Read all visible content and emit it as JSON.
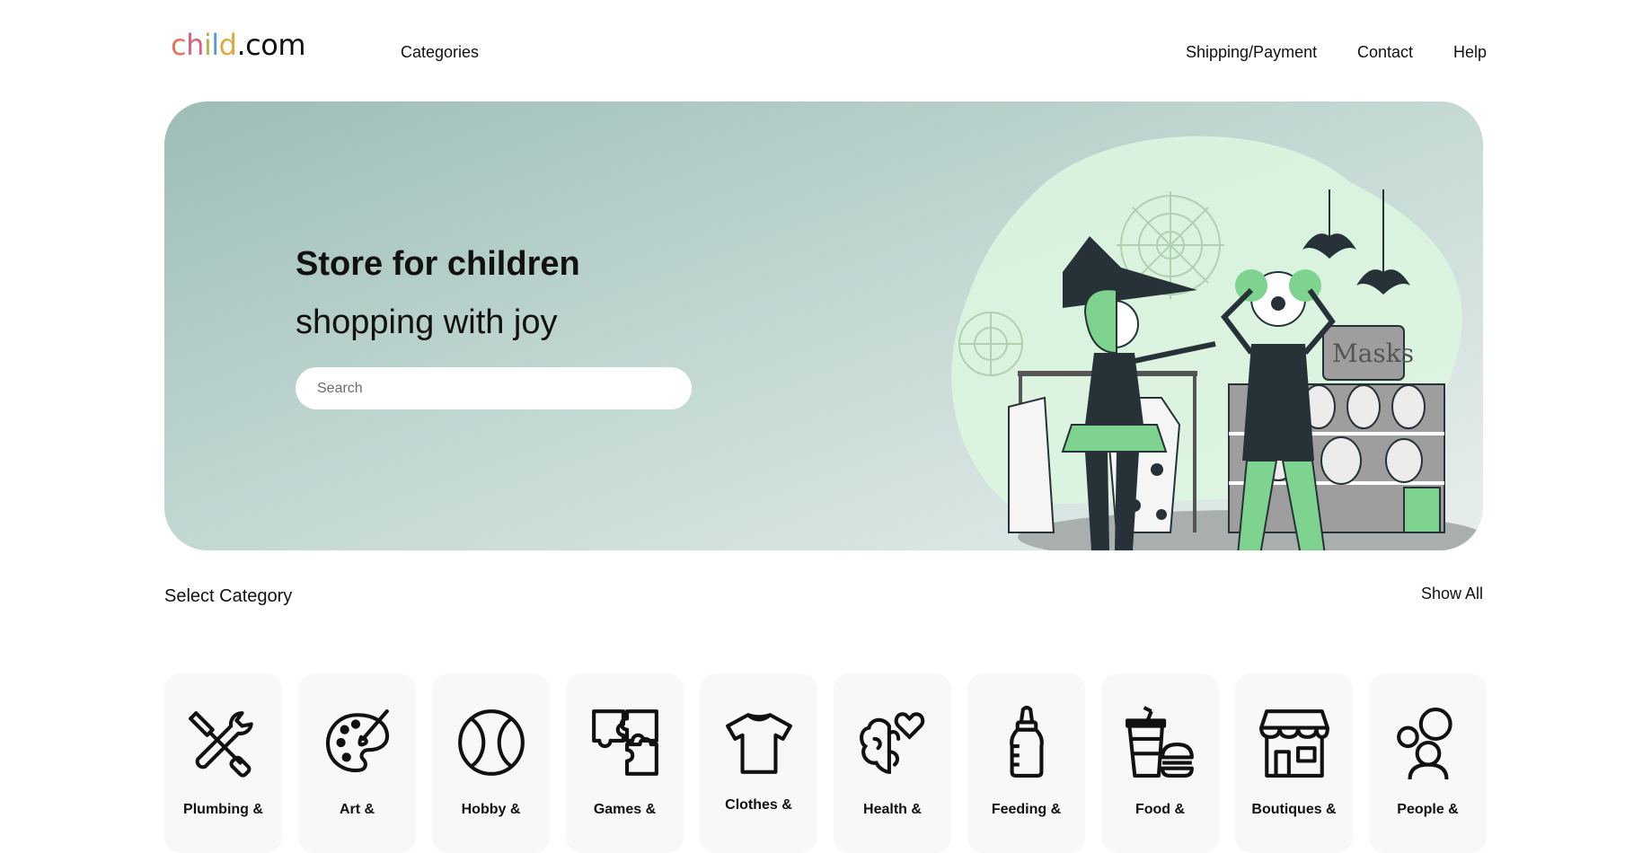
{
  "header": {
    "logo": {
      "text": "child.com",
      "letters": [
        {
          "char": "c",
          "color": "#e2745f"
        },
        {
          "char": "h",
          "color": "#d9607b"
        },
        {
          "char": "i",
          "color": "#a6b84a"
        },
        {
          "char": "l",
          "color": "#5b9bd1"
        },
        {
          "char": "d",
          "color": "#e0a93c"
        },
        {
          "char": ".com",
          "color": "#111111"
        }
      ]
    },
    "nav": {
      "categories": "Categories",
      "shipping": "Shipping/Payment",
      "contact": "Contact",
      "help": "Help"
    }
  },
  "hero": {
    "title": "Store for children",
    "subtitle": "shopping with joy",
    "search_placeholder": "Search",
    "illustration_sign": "Masks",
    "colors": {
      "gradient_start": "#9dbdb7",
      "gradient_end": "#e8efee",
      "accent_green": "#7ed38f",
      "dark": "#263238"
    }
  },
  "categories_section": {
    "title": "Select Category",
    "show_all": "Show All",
    "items": [
      {
        "label": "Plumbing &",
        "icon": "tools-icon"
      },
      {
        "label": "Art &",
        "icon": "palette-icon"
      },
      {
        "label": "Hobby &",
        "icon": "ball-icon"
      },
      {
        "label": "Games &",
        "icon": "puzzle-icon"
      },
      {
        "label": "Clothes &",
        "icon": "tshirt-icon"
      },
      {
        "label": "Health &",
        "icon": "brain-heart-icon"
      },
      {
        "label": "Feeding &",
        "icon": "baby-bottle-icon"
      },
      {
        "label": "Food &",
        "icon": "fast-food-icon"
      },
      {
        "label": "Boutiques &",
        "icon": "store-icon"
      },
      {
        "label": "People &",
        "icon": "people-icon"
      }
    ]
  }
}
